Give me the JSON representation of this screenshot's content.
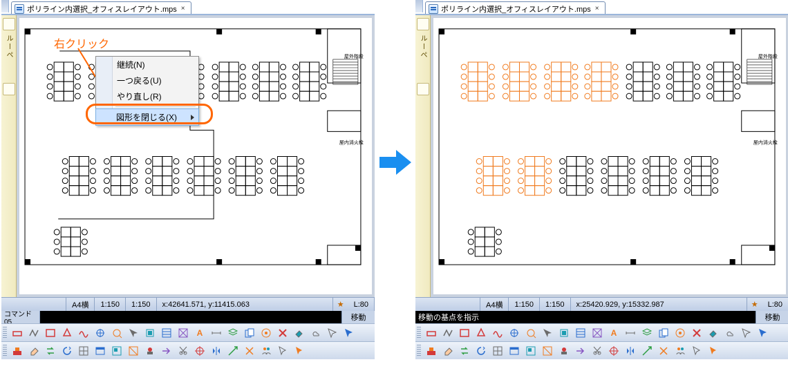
{
  "doc_title": "ポリライン内選択_オフィスレイアウト.mps",
  "callout_text": "右クリック",
  "context_menu": {
    "items": [
      {
        "label": "継続(N)",
        "highlighted": false
      },
      {
        "label": "一つ戻る(U)",
        "highlighted": false
      },
      {
        "label": "やり直し(R)",
        "highlighted": false
      }
    ],
    "sep_then": {
      "label": "図形を閉じる(X)",
      "highlighted": true,
      "has_submenu": true
    }
  },
  "left": {
    "status": {
      "paper": "A4横",
      "scale1": "1:150",
      "scale2": "1:150",
      "coords": "x:42641.571, y:11415.063",
      "layer": "L:80"
    },
    "cmd_label": "コマンド05",
    "cmd_text": "",
    "cmd_mode": "移動"
  },
  "right": {
    "status": {
      "paper": "A4横",
      "scale1": "1:150",
      "scale2": "1:150",
      "coords": "x:25420.929, y:15332.987",
      "layer": "L:80"
    },
    "cmd_text": "移動の基点を指示",
    "cmd_mode": "移動"
  },
  "strip_label": "ルーペ",
  "labels": {
    "outdoor": "屋外階段",
    "fire": "屋内消火栓"
  },
  "toolbar_colors": {
    "red": "#d33a3a",
    "blue": "#2a6dce",
    "orange": "#f07b1f",
    "green": "#2f9e44",
    "teal": "#1a9cb0",
    "purple": "#8755c2",
    "gray": "#6b6b6b"
  }
}
